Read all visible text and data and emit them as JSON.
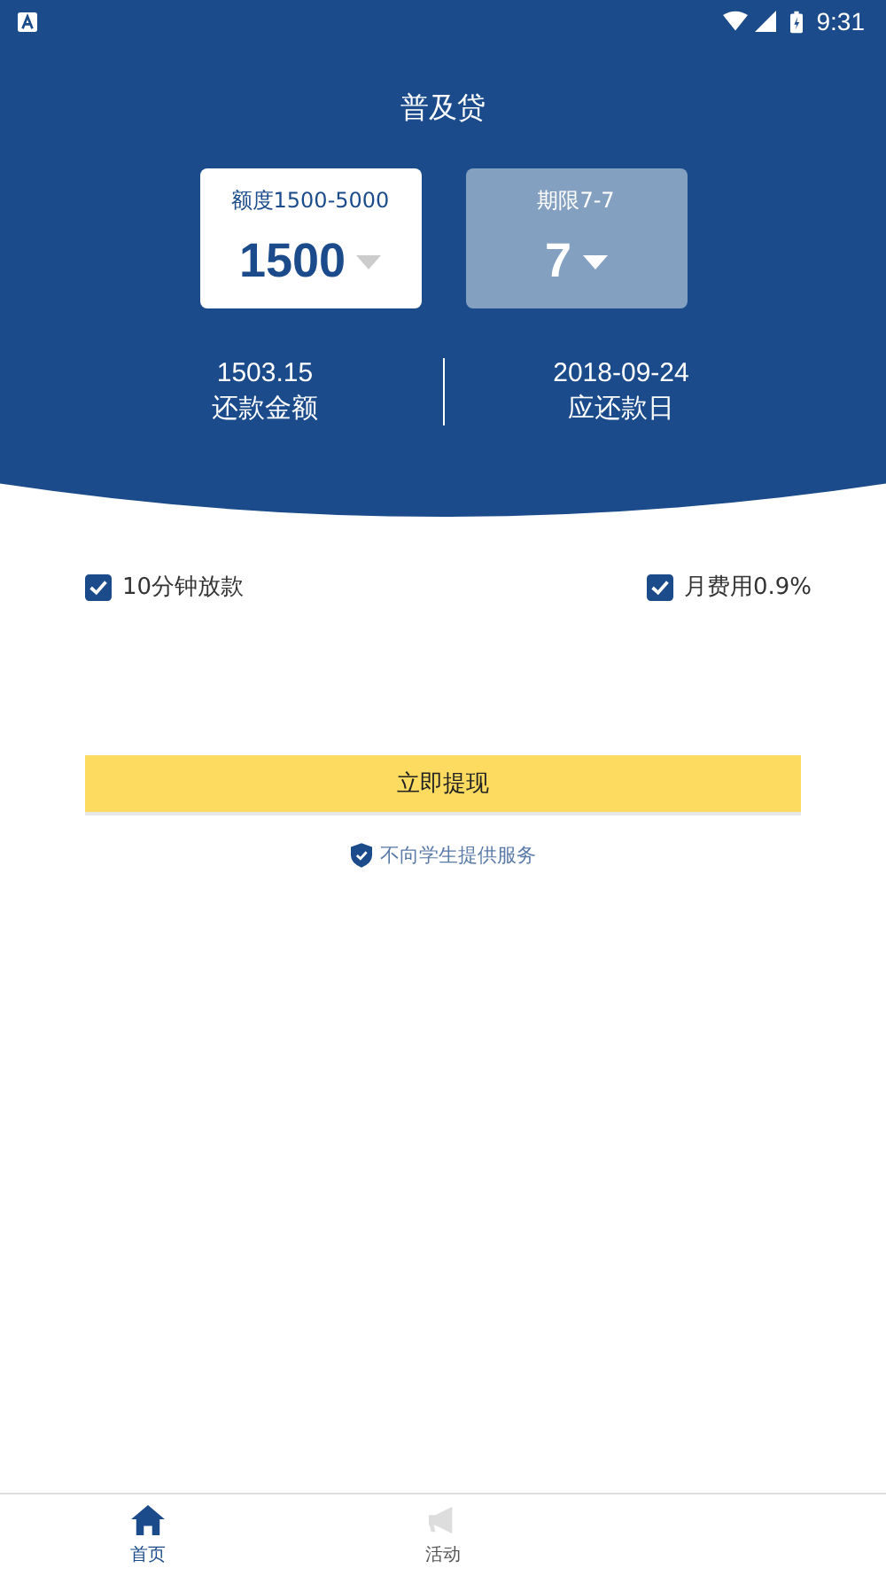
{
  "status_bar": {
    "time": "9:31"
  },
  "header": {
    "title": "普及贷"
  },
  "selectors": [
    {
      "label": "额度1500-5000",
      "value": "1500",
      "selected": true
    },
    {
      "label": "期限7-7",
      "value": "7",
      "selected": false
    }
  ],
  "summary": [
    {
      "value": "1503.15",
      "label": "还款金额"
    },
    {
      "value": "2018-09-24",
      "label": "应还款日"
    }
  ],
  "options": [
    {
      "label": "10分钟放款",
      "checked": true
    },
    {
      "label": "月费用0.9%",
      "checked": true
    }
  ],
  "submit_button": "立即提现",
  "notice": "不向学生提供服务",
  "tabs": [
    {
      "label": "首页",
      "kind": "home",
      "selected": true
    },
    {
      "label": "活动",
      "kind": "megaphone",
      "selected": false
    }
  ]
}
